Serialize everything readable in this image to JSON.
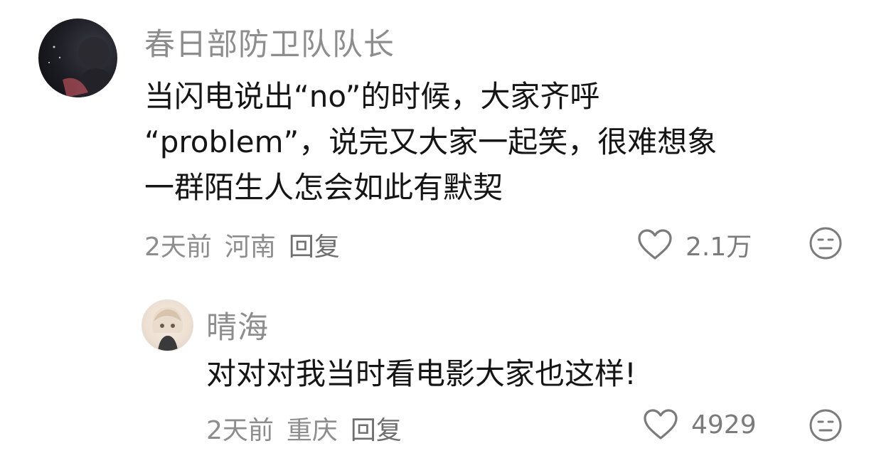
{
  "comments": [
    {
      "username": "春日部防卫队队长",
      "avatar_icon": "avatar-dark-portrait",
      "content_lines": [
        "当闪电说出“no”的时候，大家齐呼",
        "“problem”，说完又大家一起笑，很难想象",
        "一群陌生人怎会如此有默契"
      ],
      "time": "2天前",
      "location": "河南",
      "reply_label": "回复",
      "likes": "2.1万",
      "like_icon": "heart-outline-icon",
      "emoji_icon": "neutral-face-icon"
    },
    {
      "username": "晴海",
      "avatar_icon": "avatar-anime-character",
      "content_lines": [
        "对对对我当时看电影大家也这样!"
      ],
      "time": "2天前",
      "location": "重庆",
      "reply_label": "回复",
      "likes": "4929",
      "like_icon": "heart-outline-icon",
      "emoji_icon": "neutral-face-icon"
    }
  ],
  "colors": {
    "text_primary": "#151515",
    "text_secondary": "#8d8d8d",
    "background": "#ffffff"
  }
}
